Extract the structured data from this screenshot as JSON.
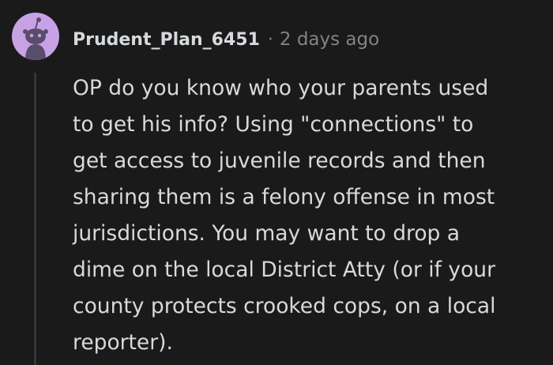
{
  "comment": {
    "username": "Prudent_Plan_6451",
    "separator": "·",
    "timestamp": "2 days ago",
    "avatar_icon": "reddit-snoo-avatar",
    "colors": {
      "background": "#1a1a1b",
      "text": "#d7dadc",
      "meta": "#818384",
      "avatar_bg": "#c7a3e6"
    },
    "body_lines": [
      "OP do you know who your parents used",
      "to get his info? Using \"connections\" to",
      "get access to juvenile records and then",
      "sharing them is a felony offense in most",
      "jurisdictions. You may want to drop a",
      "dime on the local District Atty (or if your",
      "county protects crooked cops, on a local",
      "reporter)."
    ]
  }
}
